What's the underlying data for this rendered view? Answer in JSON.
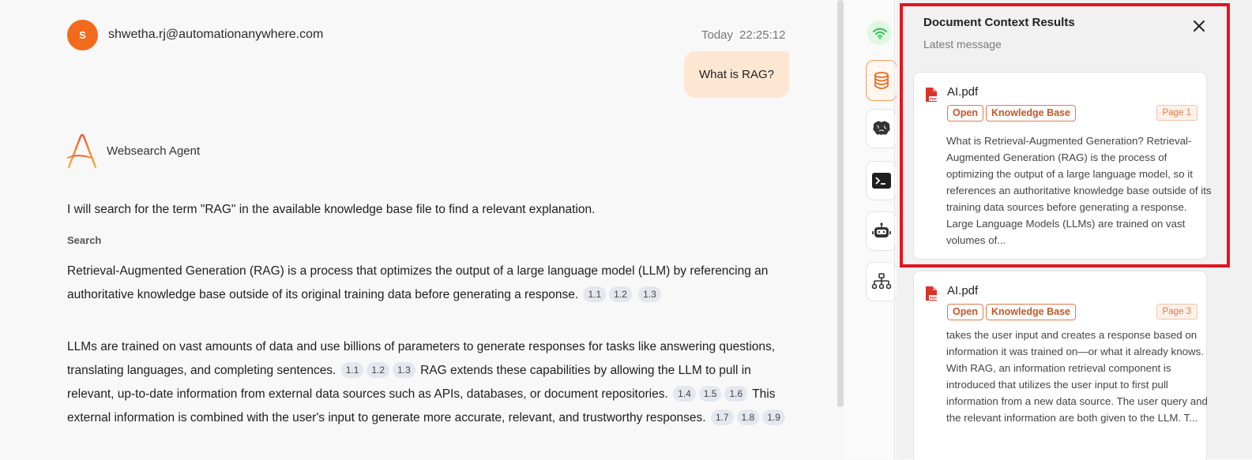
{
  "user": {
    "avatar_initial": "S",
    "email": "shwetha.rj@automationanywhere.com",
    "time_day": "Today",
    "time_clock": "22:25:12",
    "message": "What is RAG?"
  },
  "agent": {
    "name": "Websearch Agent",
    "intro": "I will search for the term \"RAG\" in the available knowledge base file to find a relevant explanation.",
    "search_label": "Search",
    "p1": {
      "text": "Retrieval-Augmented Generation (RAG) is a process that optimizes the output of a large language model (LLM) by referencing an authoritative knowledge base outside of its original training data before generating a response.",
      "cites": [
        "1.1",
        "1.2",
        "1.3"
      ]
    },
    "p2": {
      "s1": "LLMs are trained on vast amounts of data and use billions of parameters to generate responses for tasks like answering questions, translating languages, and completing sentences.",
      "c1": [
        "1.1",
        "1.2",
        "1.3"
      ],
      "s2": "RAG extends these capabilities by allowing the LLM to pull in relevant, up-to-date information from external data sources such as APIs, databases, or document repositories.",
      "c2": [
        "1.4",
        "1.5",
        "1.6"
      ],
      "s3": "This external information is combined with the user's input to generate more accurate, relevant, and trustworthy responses.",
      "c3": [
        "1.7",
        "1.8",
        "1.9"
      ]
    }
  },
  "rail": {
    "icons": [
      "wifi-icon",
      "database-icon",
      "brain-icon",
      "terminal-icon",
      "robot-icon",
      "network-icon"
    ]
  },
  "panel": {
    "title": "Document Context Results",
    "subtitle": "Latest message",
    "cards": [
      {
        "file": "AI.pdf",
        "open_label": "Open",
        "kb_label": "Knowledge Base",
        "page": "Page 1",
        "text": "What is Retrieval-Augmented Generation? Retrieval-Augmented Generation (RAG) is the process of optimizing the output of a large language model, so it references an authoritative knowledge base outside of its training data sources before generating a response. Large Language Models (LLMs) are trained on vast volumes of..."
      },
      {
        "file": "AI.pdf",
        "open_label": "Open",
        "kb_label": "Knowledge Base",
        "page": "Page 3",
        "text": "takes the user input and creates a response based on information it was trained on—or what it already knows. With RAG, an information retrieval component is introduced that utilizes the user input to first pull information from a new data source. The user query and the relevant information are both given to the LLM. T..."
      }
    ]
  },
  "colors": {
    "accent": "#f26a1b",
    "user_bubble": "#fde7d3",
    "highlight": "#e3151f",
    "tag": "#c4562a"
  }
}
